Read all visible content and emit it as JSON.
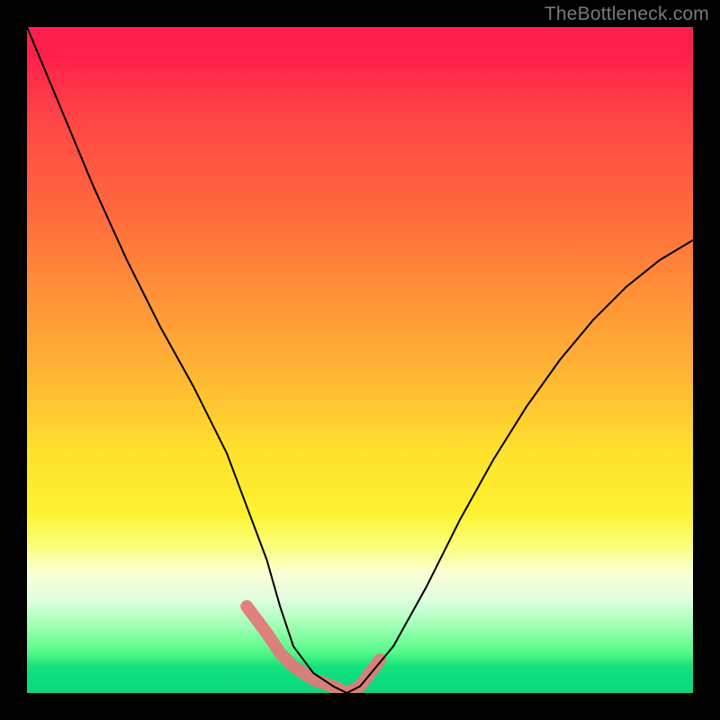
{
  "watermark": "TheBottleneck.com",
  "chart_data": {
    "type": "line",
    "title": "",
    "xlabel": "",
    "ylabel": "",
    "xlim": [
      0,
      100
    ],
    "ylim": [
      0,
      100
    ],
    "x": [
      0,
      5,
      10,
      15,
      20,
      25,
      30,
      33,
      36,
      38,
      40,
      43,
      46,
      48,
      50,
      55,
      60,
      65,
      70,
      75,
      80,
      85,
      90,
      95,
      100
    ],
    "values": [
      100,
      88,
      76,
      65,
      55,
      46,
      36,
      28,
      20,
      13,
      7,
      3,
      1,
      0,
      1,
      7,
      16,
      26,
      35,
      43,
      50,
      56,
      61,
      65,
      68
    ],
    "marker_region": {
      "x": [
        33,
        36,
        38,
        40,
        43,
        46,
        48,
        50,
        53
      ],
      "values": [
        13,
        9,
        6,
        4,
        2,
        1,
        0,
        1,
        5
      ]
    }
  }
}
